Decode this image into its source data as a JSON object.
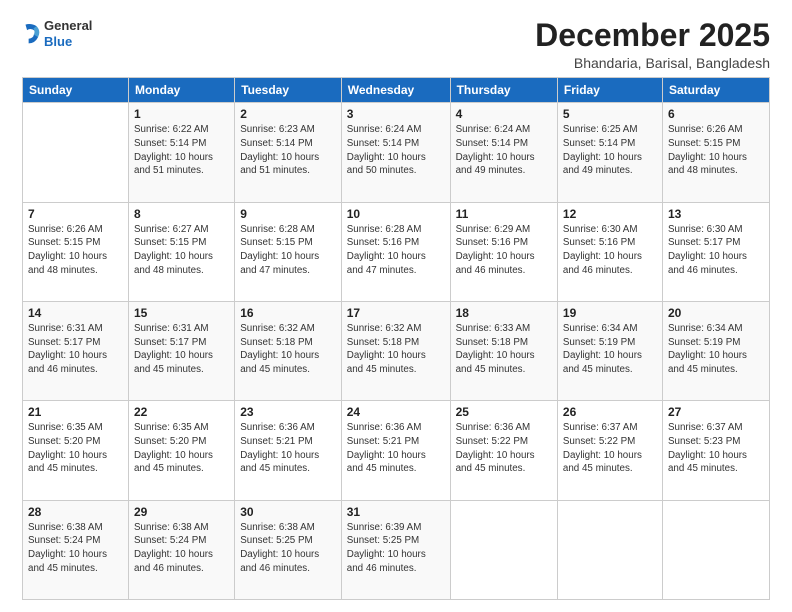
{
  "logo": {
    "general": "General",
    "blue": "Blue"
  },
  "header": {
    "month": "December 2025",
    "location": "Bhandaria, Barisal, Bangladesh"
  },
  "weekdays": [
    "Sunday",
    "Monday",
    "Tuesday",
    "Wednesday",
    "Thursday",
    "Friday",
    "Saturday"
  ],
  "weeks": [
    [
      {
        "day": "",
        "sunrise": "",
        "sunset": "",
        "daylight": ""
      },
      {
        "day": "1",
        "sunrise": "Sunrise: 6:22 AM",
        "sunset": "Sunset: 5:14 PM",
        "daylight": "Daylight: 10 hours and 51 minutes."
      },
      {
        "day": "2",
        "sunrise": "Sunrise: 6:23 AM",
        "sunset": "Sunset: 5:14 PM",
        "daylight": "Daylight: 10 hours and 51 minutes."
      },
      {
        "day": "3",
        "sunrise": "Sunrise: 6:24 AM",
        "sunset": "Sunset: 5:14 PM",
        "daylight": "Daylight: 10 hours and 50 minutes."
      },
      {
        "day": "4",
        "sunrise": "Sunrise: 6:24 AM",
        "sunset": "Sunset: 5:14 PM",
        "daylight": "Daylight: 10 hours and 49 minutes."
      },
      {
        "day": "5",
        "sunrise": "Sunrise: 6:25 AM",
        "sunset": "Sunset: 5:14 PM",
        "daylight": "Daylight: 10 hours and 49 minutes."
      },
      {
        "day": "6",
        "sunrise": "Sunrise: 6:26 AM",
        "sunset": "Sunset: 5:15 PM",
        "daylight": "Daylight: 10 hours and 48 minutes."
      }
    ],
    [
      {
        "day": "7",
        "sunrise": "Sunrise: 6:26 AM",
        "sunset": "Sunset: 5:15 PM",
        "daylight": "Daylight: 10 hours and 48 minutes."
      },
      {
        "day": "8",
        "sunrise": "Sunrise: 6:27 AM",
        "sunset": "Sunset: 5:15 PM",
        "daylight": "Daylight: 10 hours and 48 minutes."
      },
      {
        "day": "9",
        "sunrise": "Sunrise: 6:28 AM",
        "sunset": "Sunset: 5:15 PM",
        "daylight": "Daylight: 10 hours and 47 minutes."
      },
      {
        "day": "10",
        "sunrise": "Sunrise: 6:28 AM",
        "sunset": "Sunset: 5:16 PM",
        "daylight": "Daylight: 10 hours and 47 minutes."
      },
      {
        "day": "11",
        "sunrise": "Sunrise: 6:29 AM",
        "sunset": "Sunset: 5:16 PM",
        "daylight": "Daylight: 10 hours and 46 minutes."
      },
      {
        "day": "12",
        "sunrise": "Sunrise: 6:30 AM",
        "sunset": "Sunset: 5:16 PM",
        "daylight": "Daylight: 10 hours and 46 minutes."
      },
      {
        "day": "13",
        "sunrise": "Sunrise: 6:30 AM",
        "sunset": "Sunset: 5:17 PM",
        "daylight": "Daylight: 10 hours and 46 minutes."
      }
    ],
    [
      {
        "day": "14",
        "sunrise": "Sunrise: 6:31 AM",
        "sunset": "Sunset: 5:17 PM",
        "daylight": "Daylight: 10 hours and 46 minutes."
      },
      {
        "day": "15",
        "sunrise": "Sunrise: 6:31 AM",
        "sunset": "Sunset: 5:17 PM",
        "daylight": "Daylight: 10 hours and 45 minutes."
      },
      {
        "day": "16",
        "sunrise": "Sunrise: 6:32 AM",
        "sunset": "Sunset: 5:18 PM",
        "daylight": "Daylight: 10 hours and 45 minutes."
      },
      {
        "day": "17",
        "sunrise": "Sunrise: 6:32 AM",
        "sunset": "Sunset: 5:18 PM",
        "daylight": "Daylight: 10 hours and 45 minutes."
      },
      {
        "day": "18",
        "sunrise": "Sunrise: 6:33 AM",
        "sunset": "Sunset: 5:18 PM",
        "daylight": "Daylight: 10 hours and 45 minutes."
      },
      {
        "day": "19",
        "sunrise": "Sunrise: 6:34 AM",
        "sunset": "Sunset: 5:19 PM",
        "daylight": "Daylight: 10 hours and 45 minutes."
      },
      {
        "day": "20",
        "sunrise": "Sunrise: 6:34 AM",
        "sunset": "Sunset: 5:19 PM",
        "daylight": "Daylight: 10 hours and 45 minutes."
      }
    ],
    [
      {
        "day": "21",
        "sunrise": "Sunrise: 6:35 AM",
        "sunset": "Sunset: 5:20 PM",
        "daylight": "Daylight: 10 hours and 45 minutes."
      },
      {
        "day": "22",
        "sunrise": "Sunrise: 6:35 AM",
        "sunset": "Sunset: 5:20 PM",
        "daylight": "Daylight: 10 hours and 45 minutes."
      },
      {
        "day": "23",
        "sunrise": "Sunrise: 6:36 AM",
        "sunset": "Sunset: 5:21 PM",
        "daylight": "Daylight: 10 hours and 45 minutes."
      },
      {
        "day": "24",
        "sunrise": "Sunrise: 6:36 AM",
        "sunset": "Sunset: 5:21 PM",
        "daylight": "Daylight: 10 hours and 45 minutes."
      },
      {
        "day": "25",
        "sunrise": "Sunrise: 6:36 AM",
        "sunset": "Sunset: 5:22 PM",
        "daylight": "Daylight: 10 hours and 45 minutes."
      },
      {
        "day": "26",
        "sunrise": "Sunrise: 6:37 AM",
        "sunset": "Sunset: 5:22 PM",
        "daylight": "Daylight: 10 hours and 45 minutes."
      },
      {
        "day": "27",
        "sunrise": "Sunrise: 6:37 AM",
        "sunset": "Sunset: 5:23 PM",
        "daylight": "Daylight: 10 hours and 45 minutes."
      }
    ],
    [
      {
        "day": "28",
        "sunrise": "Sunrise: 6:38 AM",
        "sunset": "Sunset: 5:24 PM",
        "daylight": "Daylight: 10 hours and 45 minutes."
      },
      {
        "day": "29",
        "sunrise": "Sunrise: 6:38 AM",
        "sunset": "Sunset: 5:24 PM",
        "daylight": "Daylight: 10 hours and 46 minutes."
      },
      {
        "day": "30",
        "sunrise": "Sunrise: 6:38 AM",
        "sunset": "Sunset: 5:25 PM",
        "daylight": "Daylight: 10 hours and 46 minutes."
      },
      {
        "day": "31",
        "sunrise": "Sunrise: 6:39 AM",
        "sunset": "Sunset: 5:25 PM",
        "daylight": "Daylight: 10 hours and 46 minutes."
      },
      {
        "day": "",
        "sunrise": "",
        "sunset": "",
        "daylight": ""
      },
      {
        "day": "",
        "sunrise": "",
        "sunset": "",
        "daylight": ""
      },
      {
        "day": "",
        "sunrise": "",
        "sunset": "",
        "daylight": ""
      }
    ]
  ]
}
